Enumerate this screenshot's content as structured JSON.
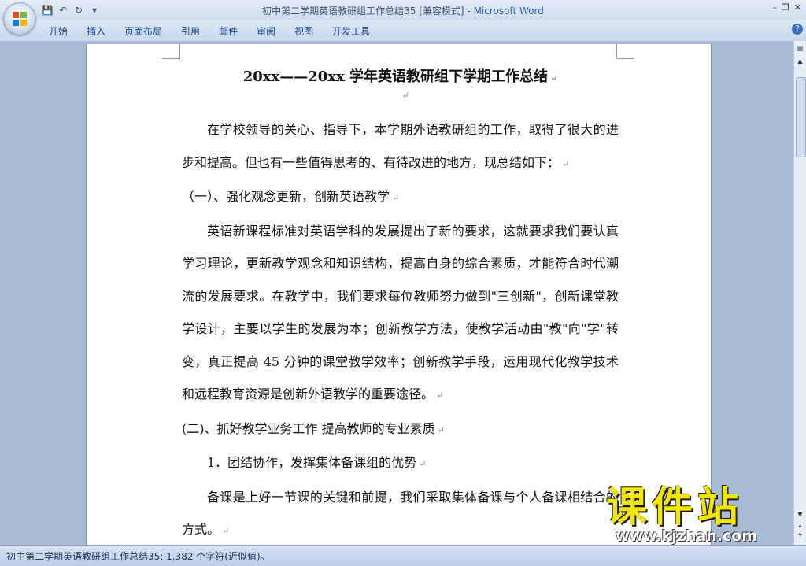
{
  "window": {
    "title": "初中第二学期英语教研组工作总结35 [兼容模式]",
    "app_name": "Microsoft Word",
    "title_separator": " - "
  },
  "quick_access": [
    "save-icon",
    "undo-icon",
    "redo-icon",
    "customize-icon"
  ],
  "ribbon": {
    "tabs": [
      "开始",
      "插入",
      "页面布局",
      "引用",
      "邮件",
      "审阅",
      "视图",
      "开发工具"
    ]
  },
  "document": {
    "title": "20xx——20xx 学年英语教研组下学期工作总结",
    "paragraphs": [
      {
        "kind": "para",
        "text": "在学校领导的关心、指导下，本学期外语教研组的工作，取得了很大的进步和提高。但也有一些值得思考的、有待改进的地方，现总结如下："
      },
      {
        "kind": "head",
        "text": "（一）、强化观念更新，创新英语教学"
      },
      {
        "kind": "para",
        "text": "英语新课程标准对英语学科的发展提出了新的要求，这就要求我们要认真学习理论，更新教学观念和知识结构，提高自身的综合素质，才能符合时代潮流的发展要求。在教学中，我们要求每位教师努力做到\"三创新\"，创新课堂教学设计，主要以学生的发展为本；创新教学方法，使教学活动由\"教\"向\"学\"转变，真正提高 45 分钟的课堂教学效率；创新教学手段，运用现代化教学技术和远程教育资源是创新外语教学的重要途径。"
      },
      {
        "kind": "head",
        "text": "(二)、抓好教学业务工作 提高教师的专业素质"
      },
      {
        "kind": "para",
        "text": "1．团结协作，发挥集体备课组的优势"
      },
      {
        "kind": "para",
        "text": "备课是上好一节课的关键和前提，我们采取集体备课与个人备课相结合的方式。"
      }
    ]
  },
  "status_bar": {
    "text": "初中第二学期英语教研组工作总结35: 1,382 个字符(近似值)。"
  },
  "watermark": {
    "cn": "课件站",
    "url": "www.kjzhan.com"
  },
  "colors": {
    "title_app": "#2a5ea8",
    "tab_text": "#15428b",
    "watermark_yellow": "#f2e600"
  }
}
